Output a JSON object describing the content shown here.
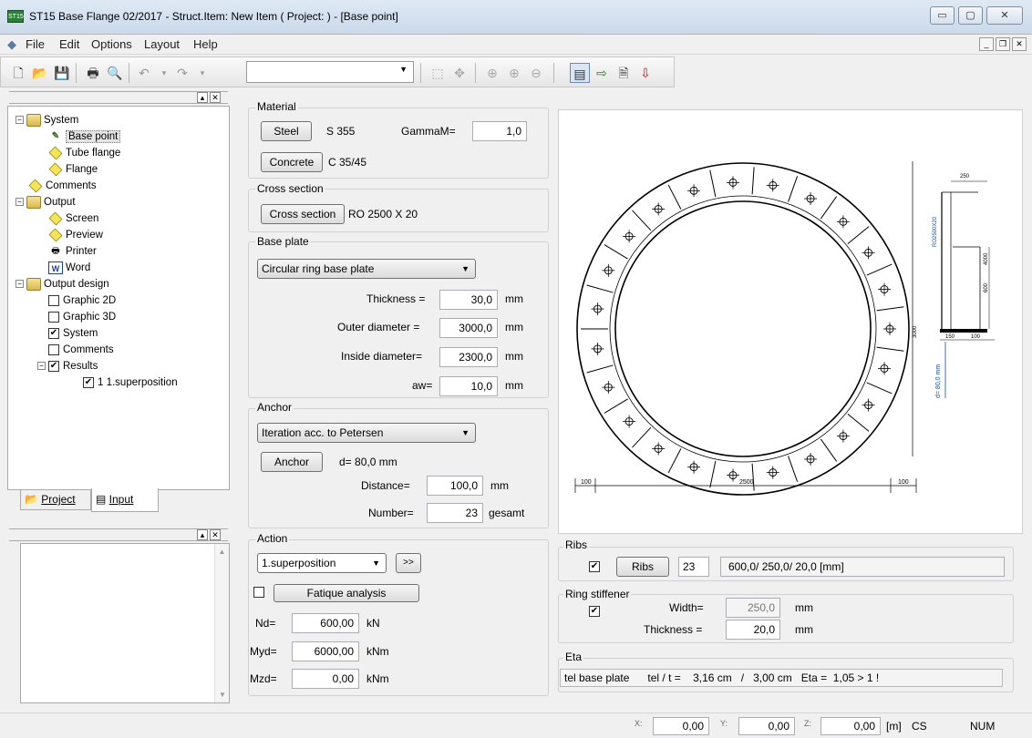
{
  "app": {
    "icon_text": "ST15",
    "title": "ST15 Base Flange  02/2017 - Struct.Item: New Item ( Project:  ) - [Base point]"
  },
  "menu": [
    "File",
    "Edit",
    "Options",
    "Layout",
    "Help"
  ],
  "toolbar": {
    "combo_value": ""
  },
  "tree": {
    "items": [
      {
        "label": "System"
      },
      {
        "label": "Base point"
      },
      {
        "label": "Tube flange"
      },
      {
        "label": "Flange"
      },
      {
        "label": "Comments"
      },
      {
        "label": "Output"
      },
      {
        "label": "Screen"
      },
      {
        "label": "Preview"
      },
      {
        "label": "Printer"
      },
      {
        "label": "Word"
      },
      {
        "label": "Output design"
      },
      {
        "label": "Graphic 2D"
      },
      {
        "label": "Graphic 3D"
      },
      {
        "label": "System"
      },
      {
        "label": "Comments"
      },
      {
        "label": "Results"
      },
      {
        "label": "1 1.superposition"
      }
    ],
    "tabs": [
      {
        "label": "Project"
      },
      {
        "label": "Input"
      }
    ]
  },
  "material": {
    "title": "Material",
    "steel_btn": "Steel",
    "steel_grade": "S 355",
    "gamma_label": "GammaM=",
    "gamma_value": "1,0",
    "concrete_btn": "Concrete",
    "concrete_grade": "C 35/45"
  },
  "cross": {
    "title": "Cross section",
    "btn": "Cross section",
    "value": "RO  2500  X  20"
  },
  "baseplate": {
    "title": "Base plate",
    "type": "Circular ring base plate",
    "thickness_label": "Thickness =",
    "thickness": "30,0",
    "outer_label": "Outer diameter =",
    "outer": "3000,0",
    "inside_label": "Inside diameter=",
    "inside": "2300,0",
    "aw_label": "aw=",
    "aw": "10,0",
    "unit": "mm"
  },
  "anchor": {
    "title": "Anchor",
    "method": "Iteration acc. to Petersen",
    "btn": "Anchor",
    "d_text": "d= 80,0 mm",
    "distance_label": "Distance=",
    "distance": "100,0",
    "distance_unit": "mm",
    "number_label": "Number=",
    "number": "23",
    "number_unit": "gesamt"
  },
  "action": {
    "title": "Action",
    "combo": "1.superposition",
    "more": ">>",
    "fatigue_btn": "Fatique analysis",
    "nd_label": "Nd=",
    "nd": "600,00",
    "nd_unit": "kN",
    "myd_label": "Myd=",
    "myd": "6000,00",
    "myd_unit": "kNm",
    "mzd_label": "Mzd=",
    "mzd": "0,00",
    "mzd_unit": "kNm"
  },
  "ribs": {
    "title": "Ribs",
    "btn": "Ribs",
    "count": "23",
    "dims": "600,0/  250,0/ 20,0 [mm]"
  },
  "ring": {
    "title": "Ring stiffener",
    "width_label": "Width=",
    "width": "250,0",
    "thick_label": "Thickness =",
    "thick": "20,0",
    "unit": "mm"
  },
  "eta": {
    "title": "Eta",
    "text": "tel base plate      tel / t =    3,16 cm   /   3,00 cm   Eta =  1,05 > 1 !"
  },
  "drawing": {
    "dim_left": "100",
    "dim_mid": "2500",
    "dim_right": "100",
    "side_top": "250",
    "side_h1": "3000",
    "side_label": "RO2500X20",
    "side_a": "150",
    "side_b": "100",
    "side_d": "d= 80,0 mm",
    "side_v1": "4000",
    "side_v2": "600"
  },
  "status": {
    "x_label": "X:",
    "x": "0,00",
    "y_label": "Y:",
    "y": "0,00",
    "z_label": "Z:",
    "z": "0,00",
    "unit": "[m]",
    "cs": "CS",
    "num": "NUM"
  }
}
